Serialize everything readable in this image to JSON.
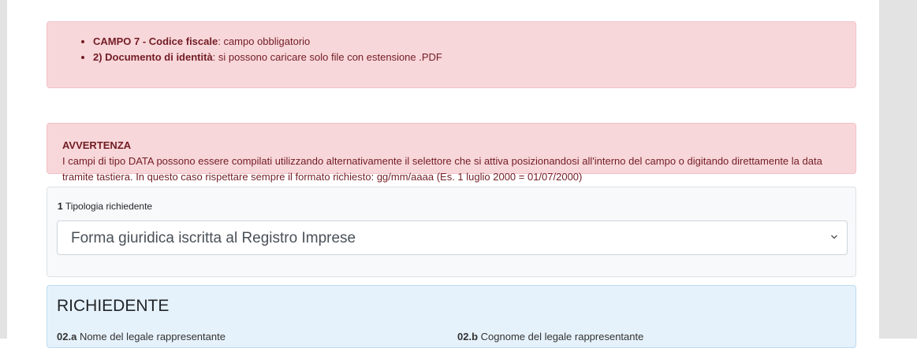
{
  "errors": [
    {
      "bold": "CAMPO 7 - Codice fiscale",
      "text": ": campo obbligatorio"
    },
    {
      "bold": "2) Documento di identità",
      "text": ": si possono caricare solo file con estensione .PDF"
    }
  ],
  "warning": {
    "title": "AVVERTENZA",
    "text": "I campi di tipo DATA possono essere compilati utilizzando alternativamente il selettore che si attiva posizionandosi all'interno del campo o digitando direttamente la data tramite tastiera. In questo caso rispettare sempre il formato richiesto: gg/mm/aaaa (Es. 1 luglio 2000 = 01/07/2000)"
  },
  "tipologia": {
    "number": "1",
    "label": "Tipologia richiedente",
    "selected": "Forma giuridica iscritta al Registro Imprese",
    "icon": "chevron-down-icon"
  },
  "richiedente": {
    "heading": "RICHIEDENTE",
    "fields": [
      {
        "number": "02.a",
        "label": "Nome del legale rappresentante"
      },
      {
        "number": "02.b",
        "label": "Cognome del legale rappresentante"
      }
    ]
  }
}
